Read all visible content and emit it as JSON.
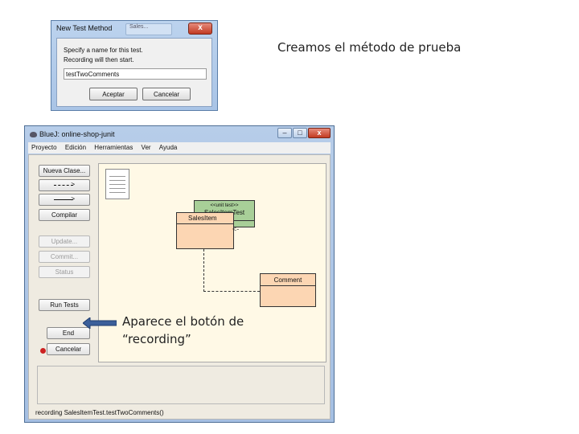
{
  "captions": {
    "top": "Creamos el método de prueba",
    "annotation_line1": "Aparece el botón de",
    "annotation_line2": "“recording”"
  },
  "dialog": {
    "title": "New Test Method",
    "background_tab": "Sales...",
    "close": "x",
    "message_line1": "Specify a name for this test.",
    "message_line2": "Recording will then start.",
    "input_value": "testTwoComments",
    "ok_label": "Aceptar",
    "cancel_label": "Cancelar"
  },
  "window": {
    "title": "BlueJ:  online-shop-junit",
    "minimize": "–",
    "maximize": "□",
    "close": "x",
    "menu": [
      "Proyecto",
      "Edición",
      "Herramientas",
      "Ver",
      "Ayuda"
    ],
    "sidebar": {
      "new_class": "Nueva Clase...",
      "compile": "Compilar",
      "update": "Update...",
      "commit": "Commit...",
      "status": "Status",
      "run_tests": "Run Tests",
      "recording": "recording",
      "end": "End",
      "cancel": "Cancelar"
    },
    "diagram": {
      "test_stereotype": "<<unit test>>",
      "test_class": "SalesItemTest",
      "sales_class": "SalesItem",
      "comment_class": "Comment"
    },
    "status_bar": "recording SalesItemTest.testTwoComments()"
  },
  "colors": {
    "accent_arrow": "#3b5f9a",
    "recording_dot": "#cc2222",
    "test_class_fill": "#a8cf98",
    "class_fill": "#fcd6b3"
  }
}
